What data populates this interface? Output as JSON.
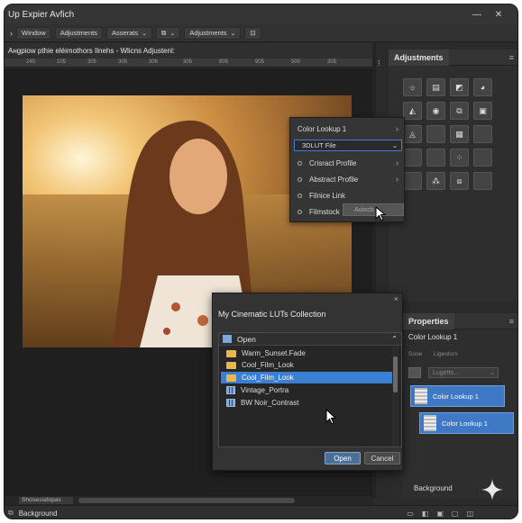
{
  "window": {
    "title": "Up Expier Avfich",
    "minimize": "—",
    "close": "✕"
  },
  "menubar": {
    "items": [
      "Window",
      "Adjustments",
      "Asserats",
      "Adjustments"
    ]
  },
  "infobar": {
    "text": "Aнgpiow pthie eléimothors Ilnehs - Wlicns Adjustenl:"
  },
  "ruler": {
    "ticks": [
      "245",
      "105",
      "305",
      "305",
      "306",
      "305",
      "805",
      "905",
      "500",
      "305"
    ]
  },
  "adjustments_panel": {
    "tab": "Adjustments"
  },
  "properties_panel": {
    "tab": "Properties",
    "layer_name": "Color Lookup 1",
    "subtabs": [
      "Sooe",
      "Ligeotors"
    ],
    "dropdown": "Lugetts...",
    "rows": [
      "Color Lookup 1",
      "Color Lookup 1"
    ],
    "footer_label": "Background"
  },
  "flyout": {
    "header": "Color Lookup 1",
    "select": "3DLUT File",
    "items": [
      "Crisract Profile",
      "Abstract Profile",
      "Filnice Link",
      "Filmstock"
    ],
    "tooltip": "Autocb"
  },
  "dialog": {
    "title": "My Cinematic LUTs Collection",
    "header": "Open",
    "files": [
      {
        "name": "Warm_Sunset.Fade",
        "kind": "folder"
      },
      {
        "name": "Cool_Film_Look",
        "kind": "folder"
      },
      {
        "name": "Cool_Film_Look",
        "kind": "folder",
        "selected": true
      },
      {
        "name": "Vintage_Portra",
        "kind": "lut"
      },
      {
        "name": "BW Noir_Contrast",
        "kind": "lut"
      }
    ],
    "open_label": "Open",
    "cancel_label": "Cancel"
  },
  "bottom": {
    "tab_label": "Shcisessdopas",
    "status": "Background"
  },
  "colors": {
    "accent": "#3b7fd4",
    "panel": "#2e2e2e",
    "app_bg": "#2b2b2b"
  }
}
